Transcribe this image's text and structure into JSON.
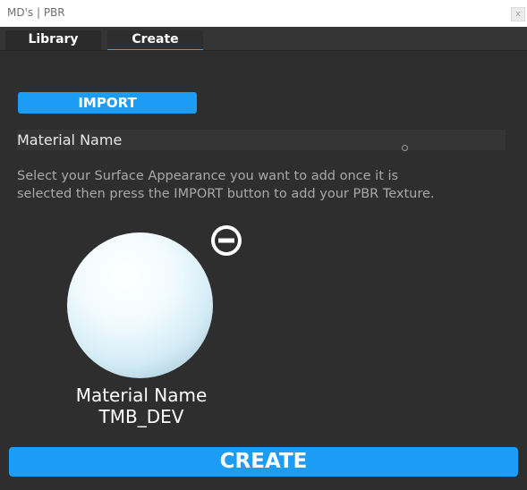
{
  "window": {
    "title": "MD's | PBR",
    "close_label": "x"
  },
  "tabs": [
    {
      "label": "Library",
      "active": false
    },
    {
      "label": "Create",
      "active": true
    }
  ],
  "create_panel": {
    "import_label": "IMPORT",
    "material_name_field": "Material Name",
    "hint": "Select your Surface Appearance you want to add once it is selected then press the IMPORT button to add your PBR Texture.",
    "preview": {
      "name": "Material Name",
      "creator": "TMB_DEV"
    },
    "create_label": "CREATE"
  },
  "colors": {
    "accent": "#1b9df5",
    "background": "#2e2e2e"
  }
}
